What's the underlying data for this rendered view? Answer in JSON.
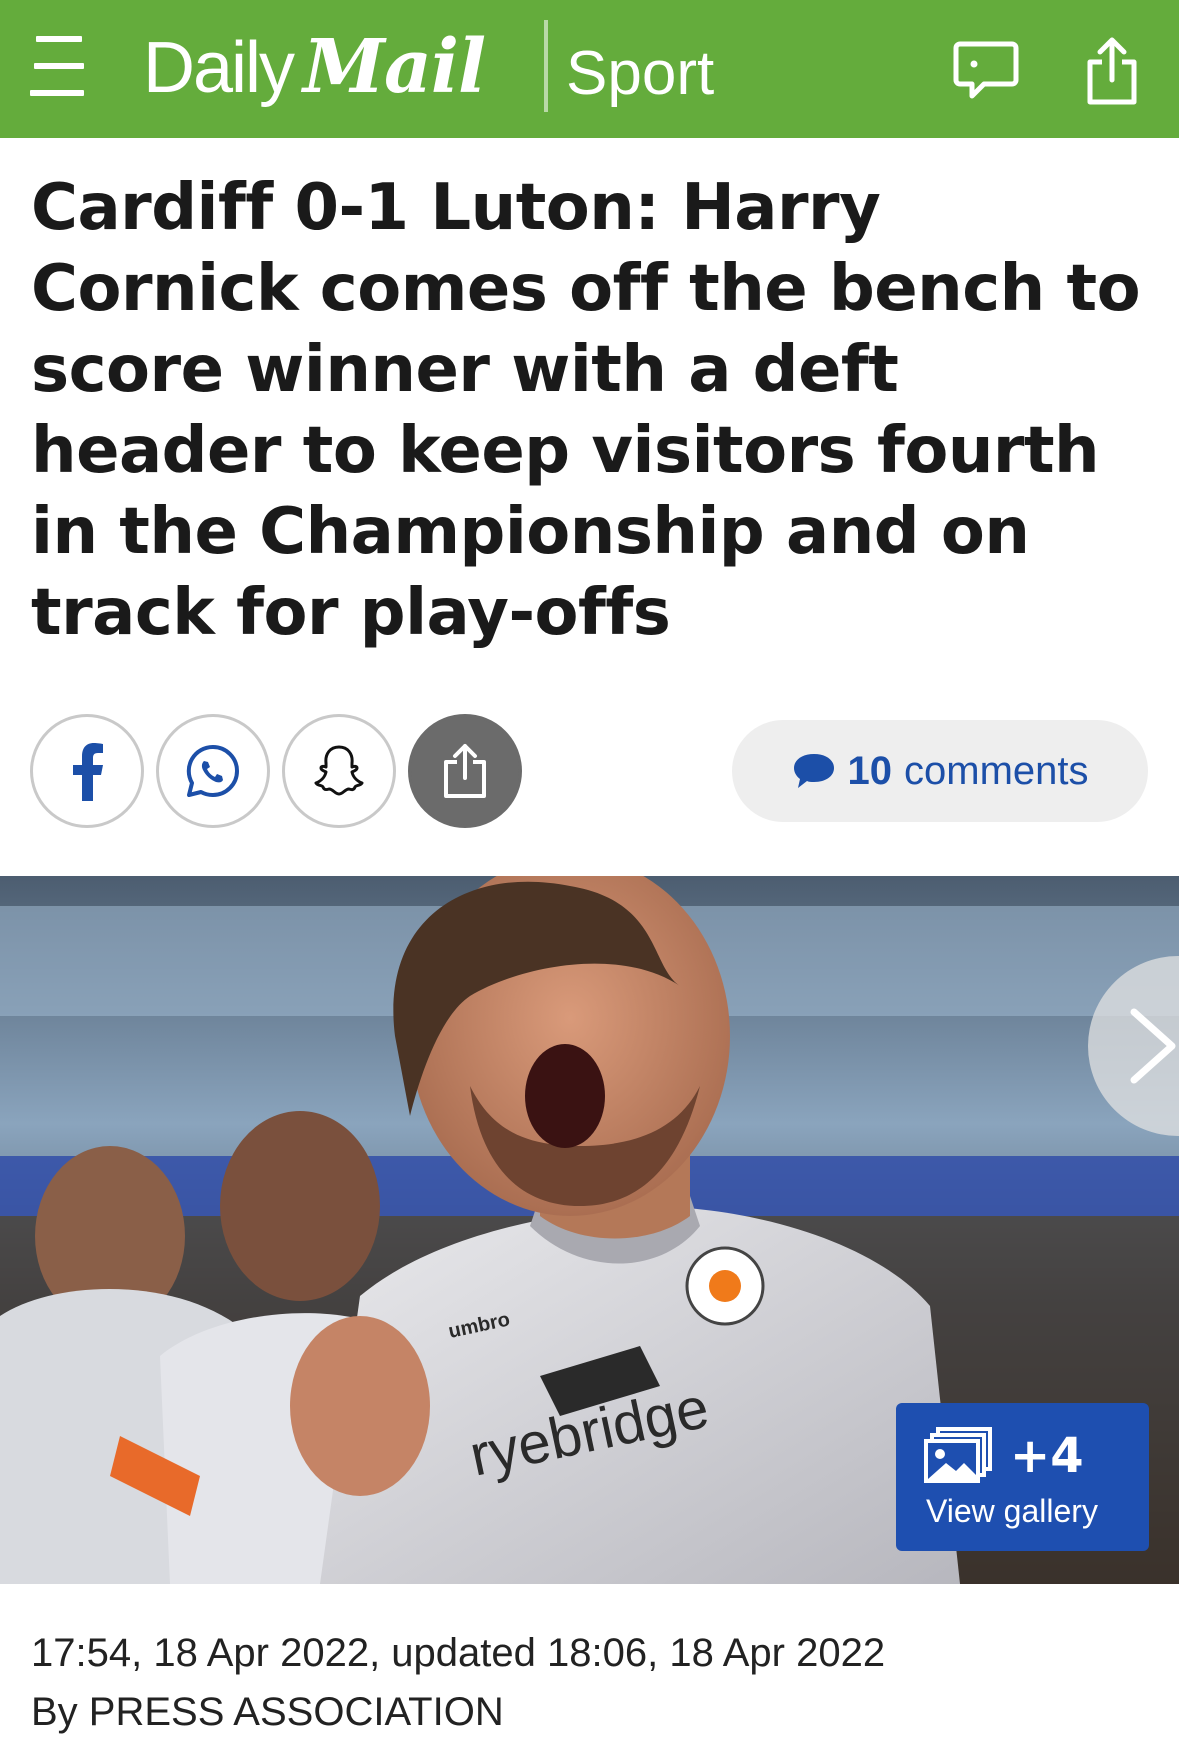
{
  "header": {
    "brand_daily": "Daily",
    "brand_mail": "Mail",
    "section": "Sport",
    "bg_color": "#64ac3c"
  },
  "article": {
    "headline": "Cardiff 0-1 Luton: Harry Cornick comes off the bench to score winner with a deft header to keep visitors fourth in the Championship and on track for play-offs",
    "timestamp": "17:54, 18 Apr 2022, updated 18:06, 18 Apr 2022",
    "byline": "By PRESS ASSOCIATION"
  },
  "social": {
    "buttons": [
      "facebook-icon",
      "whatsapp-icon",
      "snapchat-icon",
      "share-icon"
    ],
    "comments_count": "10",
    "comments_word": "comments",
    "accent_color": "#1c4fa8"
  },
  "gallery": {
    "count": "+4",
    "label": "View gallery",
    "bg_color": "#1e4fb0"
  },
  "photo": {
    "shirt_sponsor": "ryebridge",
    "shirt_maker": "umbro"
  }
}
